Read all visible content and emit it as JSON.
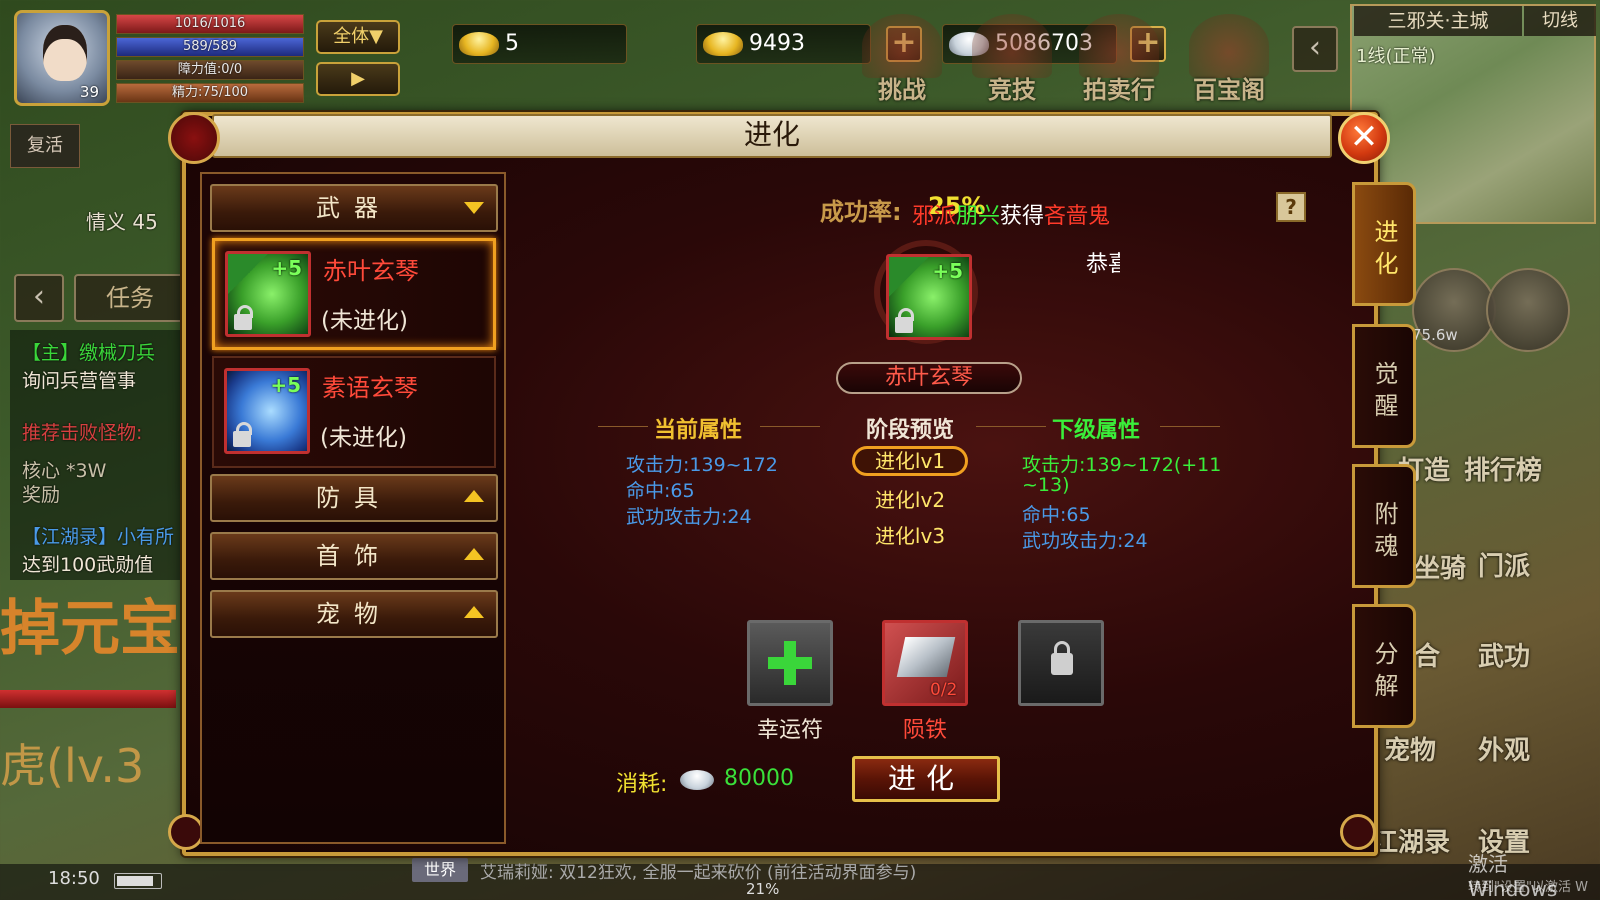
{
  "hud": {
    "level": "39",
    "hp": "1016/1016",
    "mp": "589/589",
    "barrier": "障力值:0/0",
    "energy": "精力:75/100",
    "target_all": "全体▼",
    "arrow": "▶"
  },
  "currency": {
    "gold_ingot_small": "5",
    "gold_ingot_bound": "9493",
    "silver": "5086703",
    "plus": "+"
  },
  "top_functions": [
    "挑战",
    "竞技",
    "拍卖行",
    "百宝阁"
  ],
  "minimap": {
    "map_name": "三邪关·主城",
    "line_switch": "切线",
    "line_status": "1线(正常)"
  },
  "left_side": {
    "revive": "复活",
    "chivalry": "情义 45",
    "back": "‹",
    "task": "任务",
    "quests": [
      {
        "text": "【主】缴械刀兵",
        "color": "#3ad63a"
      },
      {
        "text": "询问兵营管事",
        "color": "#f0e6d6"
      },
      {
        "text": "推荐击败怪物:",
        "color": "#d84040"
      },
      {
        "text": "核心  *3W",
        "color": "#c8c0a8"
      },
      {
        "text": "奖励",
        "color": "#c8c0a8"
      },
      {
        "text": "【江湖录】小有所",
        "color": "#4a9ae8"
      },
      {
        "text": "达到100武勋值",
        "color": "#f0e6d6"
      }
    ],
    "banner_yuanbao": "掉元宝",
    "banner_tiger": "虎(lv.3"
  },
  "bottom": {
    "clock": "18:50",
    "battery_level": 0.85,
    "chat_tag": "世界",
    "chat_text": "艾瑞莉娅: 双12狂欢, 全服一起来砍价 (前往活动界面参与)",
    "exp_percent": "21%",
    "watermark_title": "激活 Windows",
    "watermark_sub": "转到\"设置\"以激活 W"
  },
  "right_side": {
    "power": "75.6w",
    "buttons": [
      "打造",
      "排行榜",
      "坐骑",
      "门派",
      "合",
      "武功",
      "宠物",
      "外观",
      "江湖录",
      "设置"
    ]
  },
  "panel": {
    "title": "进化",
    "close": "✕",
    "categories": {
      "weapon": "武器",
      "armor": "防具",
      "jewelry": "首饰",
      "pet": "宠物"
    },
    "items": [
      {
        "name": "赤叶玄琴",
        "status": "(未进化)",
        "plus": "+5"
      },
      {
        "name": "素语玄琴",
        "status": "(未进化)",
        "plus": "+5"
      }
    ],
    "success_label": "成功率:",
    "success_value": "25%",
    "system_message": [
      {
        "text": "邪派",
        "color": "#ff3a2a"
      },
      {
        "text": "朋兴",
        "color": "#3aee3a"
      },
      {
        "text": "获得",
        "color": "#ffffff"
      },
      {
        "text": "吝啬鬼",
        "color": "#ff3a2a"
      }
    ],
    "congrats": "恭喜",
    "help": "?",
    "selected_item": {
      "name": "赤叶玄琴",
      "plus": "+5"
    },
    "current_attr_title": "当前属性",
    "stage_title": "阶段预览",
    "next_attr_title": "下级属性",
    "current_attrs": [
      "攻击力:139~172",
      "命中:65",
      "武功攻击力:24"
    ],
    "stages": [
      "进化lv1",
      "进化lv2",
      "进化lv3"
    ],
    "next_attrs": [
      "攻击力:139~172(+11",
      "~13)",
      "命中:65",
      "武功攻击力:24"
    ],
    "slots": {
      "luck_label": "幸运符",
      "meteor_label": "陨铁",
      "meteor_count": "0/2"
    },
    "cost_label": "消耗:",
    "cost_value": "80000",
    "evolve_button": "进化",
    "side_tabs": [
      "进化",
      "觉醒",
      "附魂",
      "分解"
    ]
  }
}
